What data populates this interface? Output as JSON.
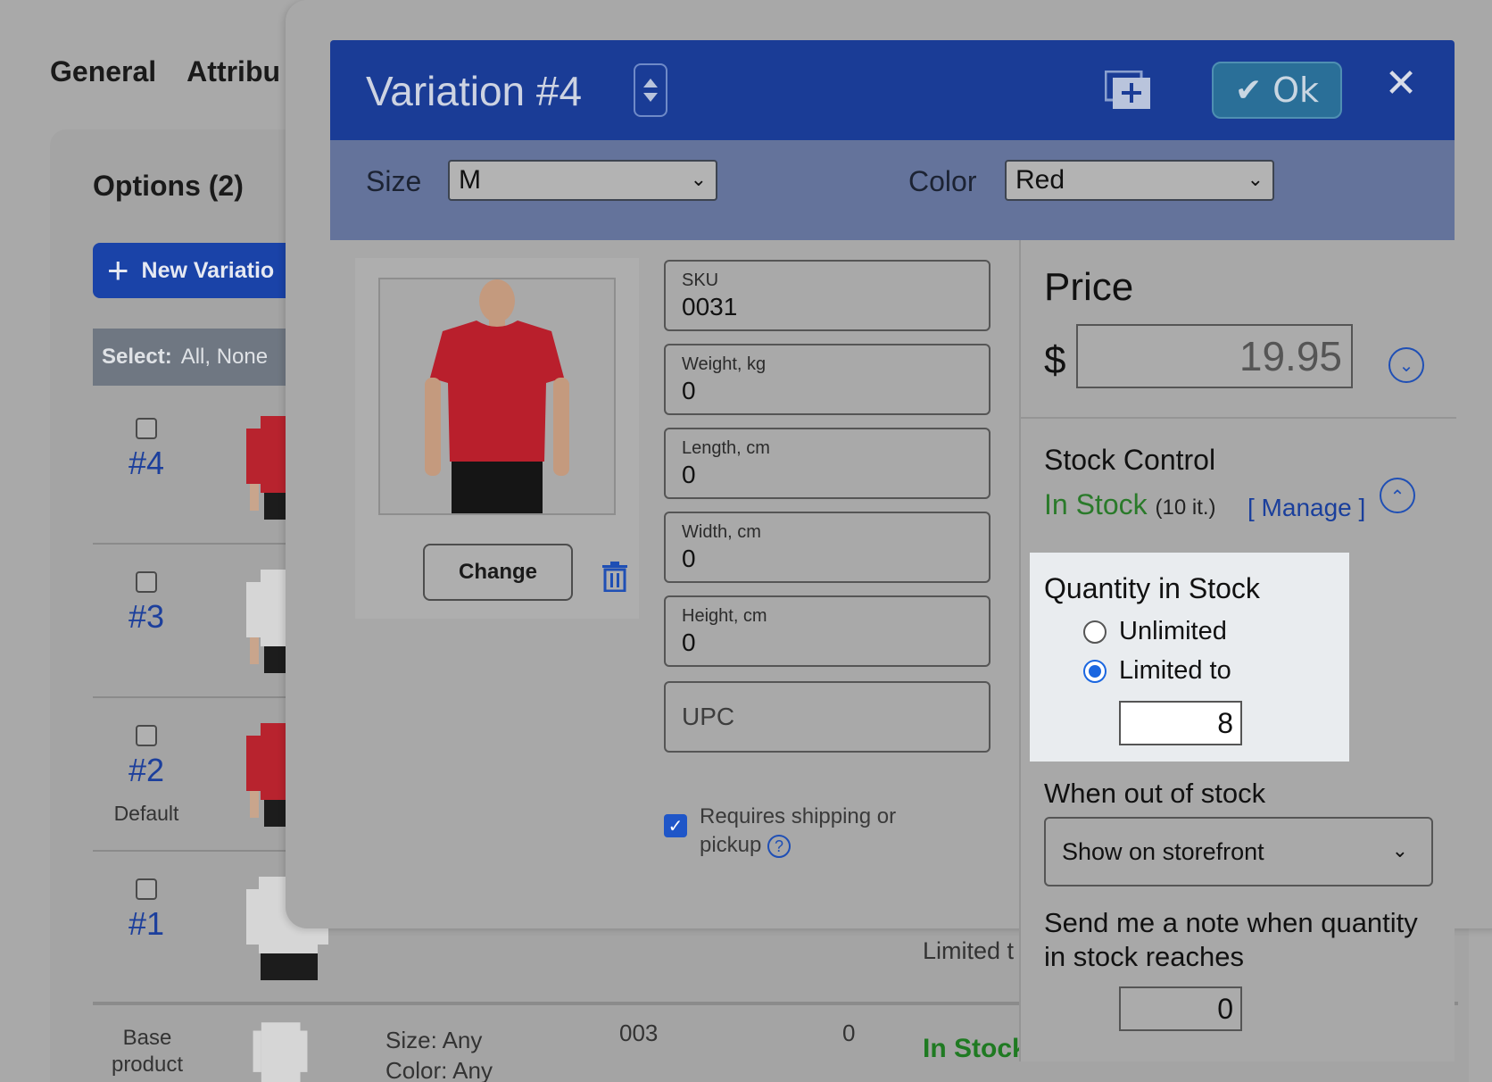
{
  "background": {
    "tabs": [
      "General",
      "Attribu"
    ],
    "options_title": "Options (2)",
    "new_variation_label": "New Variatio",
    "select_label": "Select:",
    "select_options": "All, None",
    "rows": [
      {
        "num": "#4",
        "default": ""
      },
      {
        "num": "#3",
        "default": ""
      },
      {
        "num": "#2",
        "default": "Default"
      },
      {
        "num": "#1",
        "default": ""
      }
    ],
    "limited_text": "Limited t",
    "base_row": {
      "label": "Base product",
      "size": "Size: Any",
      "color": "Color: Any",
      "sku": "003",
      "qty": "0",
      "stock": "In Stock"
    }
  },
  "modal": {
    "title": "Variation #4",
    "ok_label": "Ok",
    "close_glyph": "✕",
    "attributes": {
      "size_label": "Size",
      "size_value": "M",
      "color_label": "Color",
      "color_value": "Red"
    },
    "image": {
      "change_label": "Change"
    },
    "fields": [
      {
        "label": "SKU",
        "value": "0031"
      },
      {
        "label": "Weight, kg",
        "value": "0"
      },
      {
        "label": "Length, cm",
        "value": "0"
      },
      {
        "label": "Width, cm",
        "value": "0"
      },
      {
        "label": "Height, cm",
        "value": "0"
      }
    ],
    "upc_placeholder": "UPC",
    "shipping": {
      "checked": true,
      "label": "Requires shipping or pickup",
      "help_glyph": "?"
    },
    "price": {
      "title": "Price",
      "currency": "$",
      "value": "19.95"
    },
    "stock": {
      "title": "Stock Control",
      "status": "In Stock",
      "count": "(10 it.)",
      "manage_label": "[ Manage ]",
      "quantity_title": "Quantity in Stock",
      "unlimited_label": "Unlimited",
      "limited_label": "Limited to",
      "limited_value": "8",
      "selected": "limited",
      "out_of_stock_title": "When out of stock",
      "out_of_stock_value": "Show on storefront",
      "note_label": "Send me a note when quantity in stock reaches",
      "note_value": "0"
    }
  },
  "colors": {
    "header_blue": "#1a3c96",
    "attribute_bar": "#64739b",
    "link_blue": "#1a3f9c",
    "in_stock_green": "#2a7a2a",
    "radio_blue": "#1a66e0"
  }
}
